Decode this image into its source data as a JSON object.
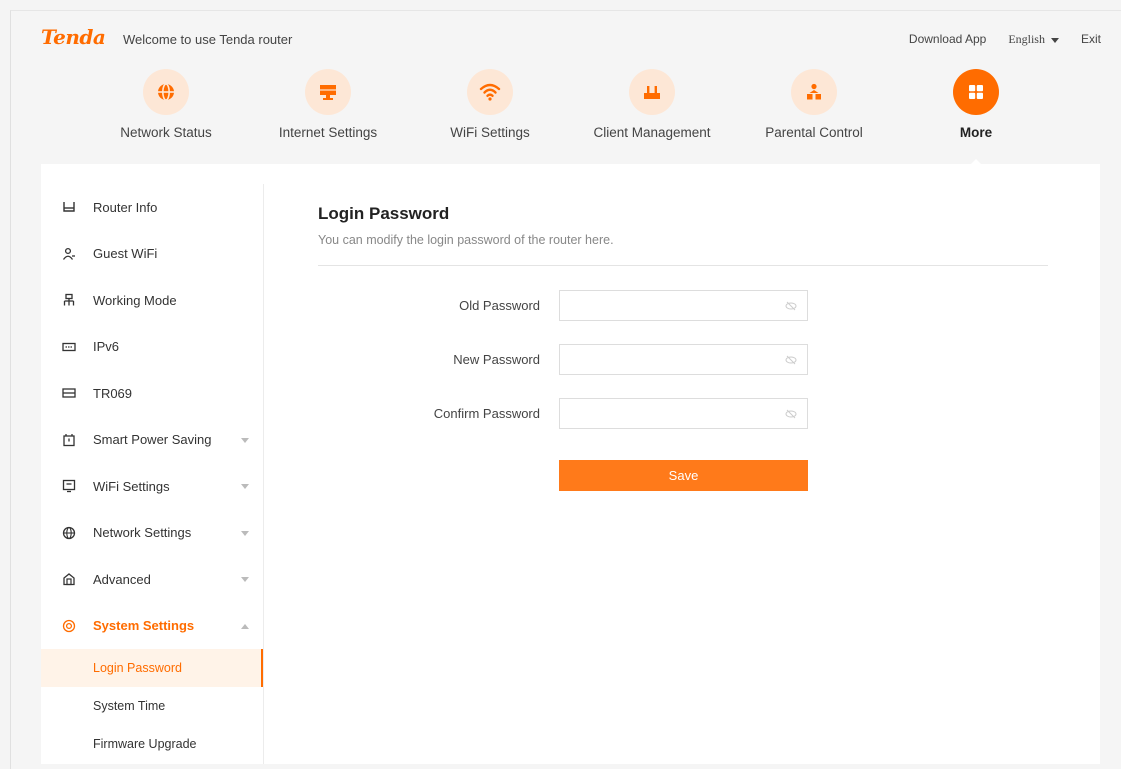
{
  "header": {
    "logo": "Tenda",
    "welcome": "Welcome to use Tenda router",
    "download_app": "Download App",
    "language": "English",
    "exit": "Exit"
  },
  "nav": {
    "items": [
      {
        "label": "Network Status",
        "icon": "globe-icon"
      },
      {
        "label": "Internet Settings",
        "icon": "monitor-icon"
      },
      {
        "label": "WiFi Settings",
        "icon": "wifi-icon"
      },
      {
        "label": "Client Management",
        "icon": "router-icon"
      },
      {
        "label": "Parental Control",
        "icon": "family-icon"
      },
      {
        "label": "More",
        "icon": "grid-icon",
        "active": true
      }
    ]
  },
  "sidebar": {
    "items": [
      {
        "label": "Router Info",
        "icon": "router-info-icon"
      },
      {
        "label": "Guest WiFi",
        "icon": "guest-icon"
      },
      {
        "label": "Working Mode",
        "icon": "network-tree-icon"
      },
      {
        "label": "IPv6",
        "icon": "ipv6-icon"
      },
      {
        "label": "TR069",
        "icon": "tr069-icon"
      },
      {
        "label": "Smart Power Saving",
        "icon": "power-saving-icon"
      },
      {
        "label": "WiFi Settings",
        "icon": "wifi-settings-icon"
      },
      {
        "label": "Network Settings",
        "icon": "globe-small-icon"
      },
      {
        "label": "Advanced",
        "icon": "advanced-icon"
      },
      {
        "label": "System Settings",
        "icon": "system-settings-icon"
      }
    ],
    "sub_items": [
      {
        "label": "Login Password",
        "active": true
      },
      {
        "label": "System Time"
      },
      {
        "label": "Firmware Upgrade"
      }
    ]
  },
  "content": {
    "title": "Login Password",
    "subtitle": "You can modify the login password of the router here.",
    "fields": [
      {
        "label": "Old Password",
        "value": "",
        "placeholder": ""
      },
      {
        "label": "New Password",
        "value": "",
        "placeholder": ""
      },
      {
        "label": "Confirm Password",
        "value": "",
        "placeholder": ""
      }
    ],
    "save_label": "Save"
  },
  "colors": {
    "accent": "#ff6c00",
    "accent_light": "#fde7d6",
    "active_bg": "#fff3e8"
  }
}
